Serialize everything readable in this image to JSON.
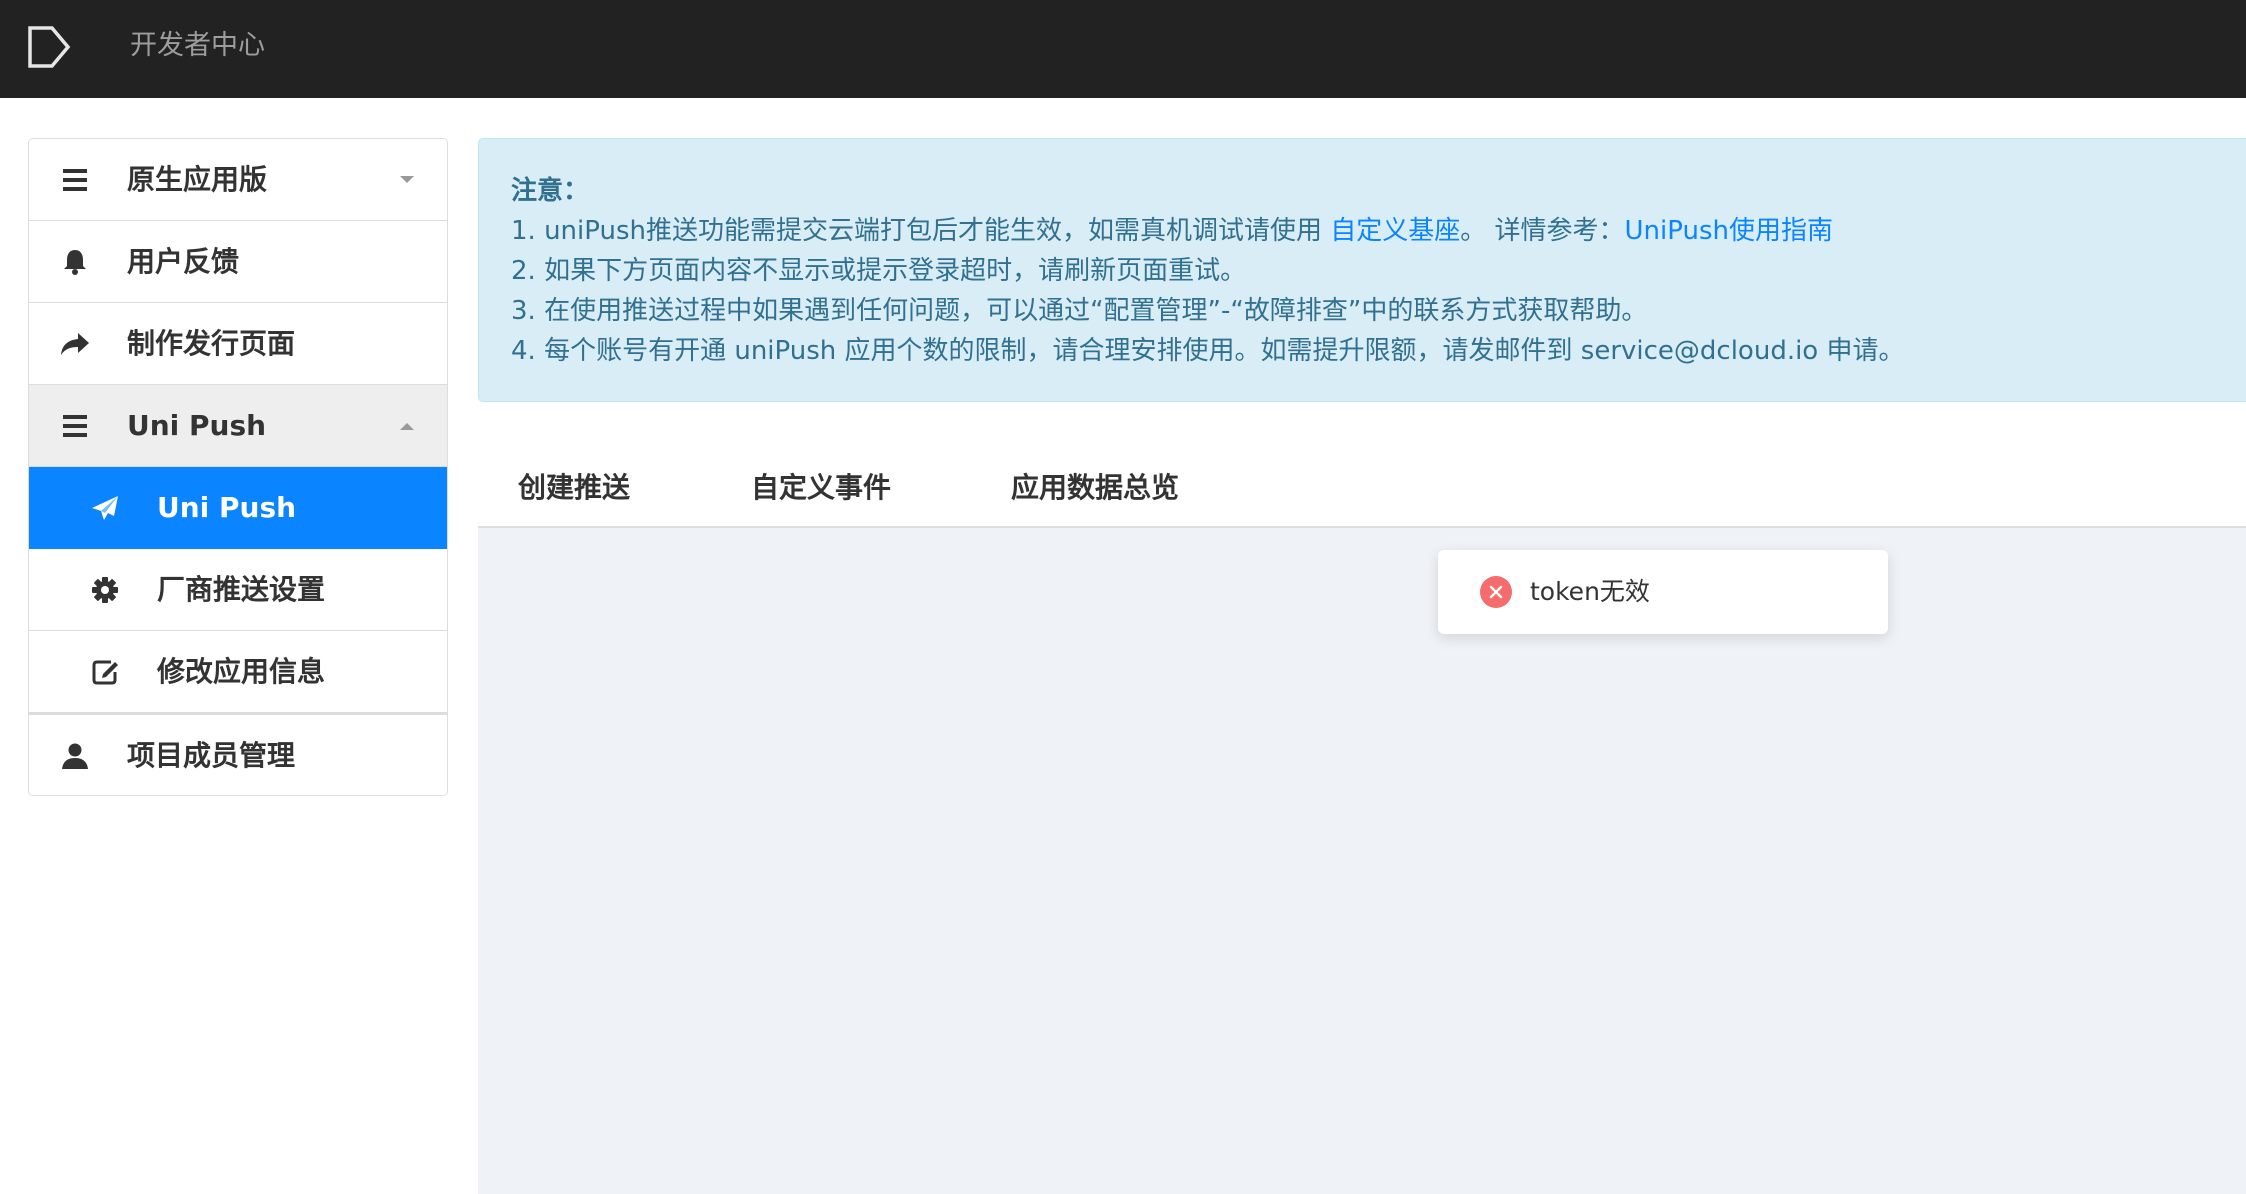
{
  "header": {
    "brand": "开发者中心",
    "logo_icon": "play-outline-icon"
  },
  "sidebar": {
    "items": [
      {
        "label": "原生应用版",
        "icon": "bars-icon",
        "caret": "down"
      },
      {
        "label": "用户反馈",
        "icon": "bell-icon"
      },
      {
        "label": "制作发行页面",
        "icon": "share-arrow-icon"
      },
      {
        "label": "Uni Push",
        "icon": "bars-icon",
        "caret": "up",
        "expanded": true
      },
      {
        "label": "Uni Push",
        "icon": "paper-plane-icon",
        "active": true
      },
      {
        "label": "厂商推送设置",
        "icon": "gear-icon"
      },
      {
        "label": "修改应用信息",
        "icon": "edit-icon"
      },
      {
        "label": "项目成员管理",
        "icon": "user-icon"
      }
    ]
  },
  "alert": {
    "title": "注意：",
    "line1_prefix": "1. uniPush推送功能需提交云端打包后才能生效，如需真机调试请使用 ",
    "line1_link1": "自定义基座",
    "line1_middle": "。 详情参考：",
    "line1_link2": "UniPush使用指南",
    "line2": "2. 如果下方页面内容不显示或提示登录超时，请刷新页面重试。",
    "line3": "3. 在使用推送过程中如果遇到任何问题，可以通过“配置管理”-“故障排查”中的联系方式获取帮助。",
    "line4": "4. 每个账号有开通 uniPush 应用个数的限制，请合理安排使用。如需提升限额，请发邮件到 service@dcloud.io 申请。"
  },
  "tabs": [
    "创建推送",
    "自定义事件",
    "应用数据总览"
  ],
  "toast": {
    "message": "token无效",
    "icon": "error-circle-icon"
  },
  "colors": {
    "topbar": "#222222",
    "accent": "#0a84ff",
    "alert_bg": "#d9edf7",
    "alert_text": "#31708f",
    "content_bg": "#eff3f7",
    "error": "#f56c6c"
  }
}
